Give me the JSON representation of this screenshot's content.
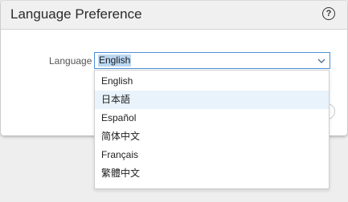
{
  "dialog": {
    "title": "Language Preference",
    "help_glyph": "?",
    "help_icon": "question-circle-icon"
  },
  "language_field": {
    "label": "Language",
    "selected_value": "English",
    "chevron_icon": "chevron-down-icon"
  },
  "dropdown": {
    "options": [
      "English",
      "日本語",
      "Español",
      "简体中文",
      "Français",
      "繁體中文"
    ],
    "hovered_index": 1
  },
  "colors": {
    "header_bg": "#f0f0f0",
    "focus_border": "#4a8fd6",
    "selection_highlight": "#bcd7f3",
    "hover_option": "#e9f3fb"
  }
}
